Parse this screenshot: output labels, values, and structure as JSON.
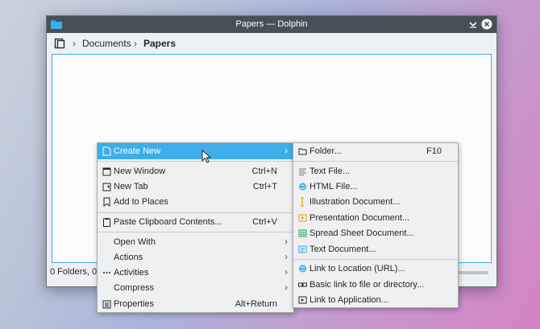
{
  "window": {
    "title": "Papers — Dolphin",
    "breadcrumb": [
      "Documents",
      "Papers"
    ],
    "status_text": "0 Folders, 0"
  },
  "context_menu": {
    "create_new": "Create New",
    "new_window": "New Window",
    "new_window_shortcut": "Ctrl+N",
    "new_tab": "New Tab",
    "new_tab_shortcut": "Ctrl+T",
    "add_to_places": "Add to Places",
    "paste": "Paste Clipboard Contents...",
    "paste_shortcut": "Ctrl+V",
    "open_with": "Open With",
    "actions": "Actions",
    "activities": "Activities",
    "compress": "Compress",
    "properties": "Properties",
    "properties_shortcut": "Alt+Return"
  },
  "submenu": {
    "folder": "Folder...",
    "folder_shortcut": "F10",
    "text_file": "Text File...",
    "html_file": "HTML File...",
    "illustration": "Illustration Document...",
    "presentation": "Presentation Document...",
    "spreadsheet": "Spread Sheet Document...",
    "text_document": "Text Document...",
    "link_url": "Link to Location (URL)...",
    "basic_link": "Basic link to file or directory...",
    "link_app": "Link to Application..."
  },
  "colors": {
    "accent": "#3daee9",
    "titlebar": "#475057",
    "menu_bg": "#eff0f1"
  },
  "icons": [
    "folder-app-icon",
    "minimize-icon",
    "close-icon",
    "places-icon"
  ]
}
